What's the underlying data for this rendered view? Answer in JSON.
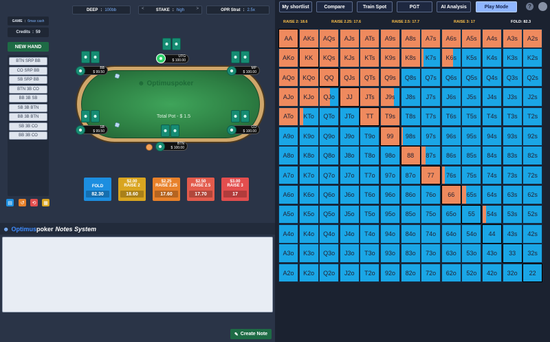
{
  "top": {
    "deep_label": "DEEP",
    "deep_value": "100bb",
    "stake_label": "STAKE",
    "stake_value": "high",
    "opr_label": "OPR Strat",
    "opr_value": "2.5x",
    "arrow_left": "<",
    "arrow_right": ">"
  },
  "sidebar": {
    "game_label": "GAME",
    "game_value": "6max cash",
    "credits_label": "Credits",
    "credits_value": "59",
    "new_hand": "NEW HAND",
    "scenarios": [
      "BTN SRP BB",
      "CO SRP BB",
      "SB SRP BB",
      "BTN 3B CO",
      "BB 3B SB",
      "SB 3B BTN",
      "BB 3B BTN",
      "SB 3B CO",
      "BB 3B CO"
    ]
  },
  "table": {
    "logo": "Optimuspoker",
    "pot": "Total Pot - $ 1.5",
    "seats": [
      {
        "pos": "BB",
        "stack": "$ 99.50"
      },
      {
        "pos": "UTG",
        "stack": "$ 100.00"
      },
      {
        "pos": "MP",
        "stack": "$ 100.00"
      },
      {
        "pos": "SB",
        "stack": "$ 99.50"
      },
      {
        "pos": "BTN",
        "stack": "$ 100.00"
      },
      {
        "pos": "CO",
        "stack": "$ 100.00"
      }
    ]
  },
  "actions": [
    {
      "label": "FOLD",
      "label2": "",
      "value": "82.30",
      "color": "#1c8ee0"
    },
    {
      "label": "$2.00",
      "label2": "RAISE 2",
      "value": "18.60",
      "color": "#d9a520"
    },
    {
      "label": "$2.25",
      "label2": "RAISE 2.25",
      "value": "17.60",
      "color": "#e8812a"
    },
    {
      "label": "$2.50",
      "label2": "RAISE 2.5",
      "value": "17.70",
      "color": "#e35b4c"
    },
    {
      "label": "$3.00",
      "label2": "RAISE 3",
      "value": "17",
      "color": "#e34e4e"
    }
  ],
  "notes": {
    "brand1": "Optimus",
    "brand2": "poker",
    "title": "Notes System",
    "create": "Create Note"
  },
  "toolbar": [
    "My shortlist",
    "Compare",
    "Train Spot",
    "PGT",
    "AI Analysis",
    "Play Mode"
  ],
  "help": "?",
  "range_headers": [
    "RAISE 2: 18.6",
    "RAISE 2.25: 17.6",
    "RAISE 2.5: 17.7",
    "RAISE 3: 17",
    "FOLD: 82.3"
  ],
  "colors": {
    "raise": "#ef8a5e",
    "fold": "#1aa6e6",
    "diag_border": "#000000"
  },
  "grid": {
    "ranks": [
      "A",
      "K",
      "Q",
      "J",
      "T",
      "9",
      "8",
      "7",
      "6",
      "5",
      "4",
      "3",
      "2"
    ],
    "raise_fraction": [
      [
        1,
        1,
        1,
        1,
        1,
        1,
        1,
        1,
        1,
        1,
        1,
        1,
        1
      ],
      [
        1,
        1,
        1,
        1,
        1,
        1,
        1,
        0.1,
        0.6,
        0,
        0,
        0,
        0
      ],
      [
        1,
        1,
        1,
        1,
        1,
        1,
        0,
        0,
        0,
        0,
        0,
        0,
        0
      ],
      [
        1,
        1,
        0.55,
        1,
        1,
        0.7,
        0,
        0,
        0,
        0,
        0,
        0,
        0
      ],
      [
        1,
        0.2,
        0,
        0,
        1,
        1,
        0,
        0,
        0,
        0,
        0,
        0,
        0
      ],
      [
        0,
        0,
        0,
        0,
        0,
        1,
        0.1,
        0,
        0,
        0,
        0,
        0,
        0
      ],
      [
        0,
        0,
        0,
        0,
        0,
        0,
        1,
        0.2,
        0,
        0,
        0,
        0,
        0
      ],
      [
        0,
        0,
        0,
        0,
        0,
        0,
        0,
        1,
        0.15,
        0,
        0,
        0,
        0
      ],
      [
        0,
        0,
        0,
        0,
        0,
        0,
        0,
        0,
        1,
        0.2,
        0,
        0,
        0
      ],
      [
        0,
        0,
        0,
        0,
        0,
        0,
        0,
        0,
        0,
        0,
        0.2,
        0,
        0
      ],
      [
        0,
        0,
        0,
        0,
        0,
        0,
        0,
        0,
        0,
        0,
        0,
        0,
        0
      ],
      [
        0,
        0,
        0,
        0,
        0,
        0,
        0,
        0,
        0,
        0,
        0,
        0,
        0
      ],
      [
        0,
        0,
        0,
        0,
        0,
        0,
        0,
        0,
        0,
        0,
        0,
        0,
        0
      ]
    ]
  }
}
